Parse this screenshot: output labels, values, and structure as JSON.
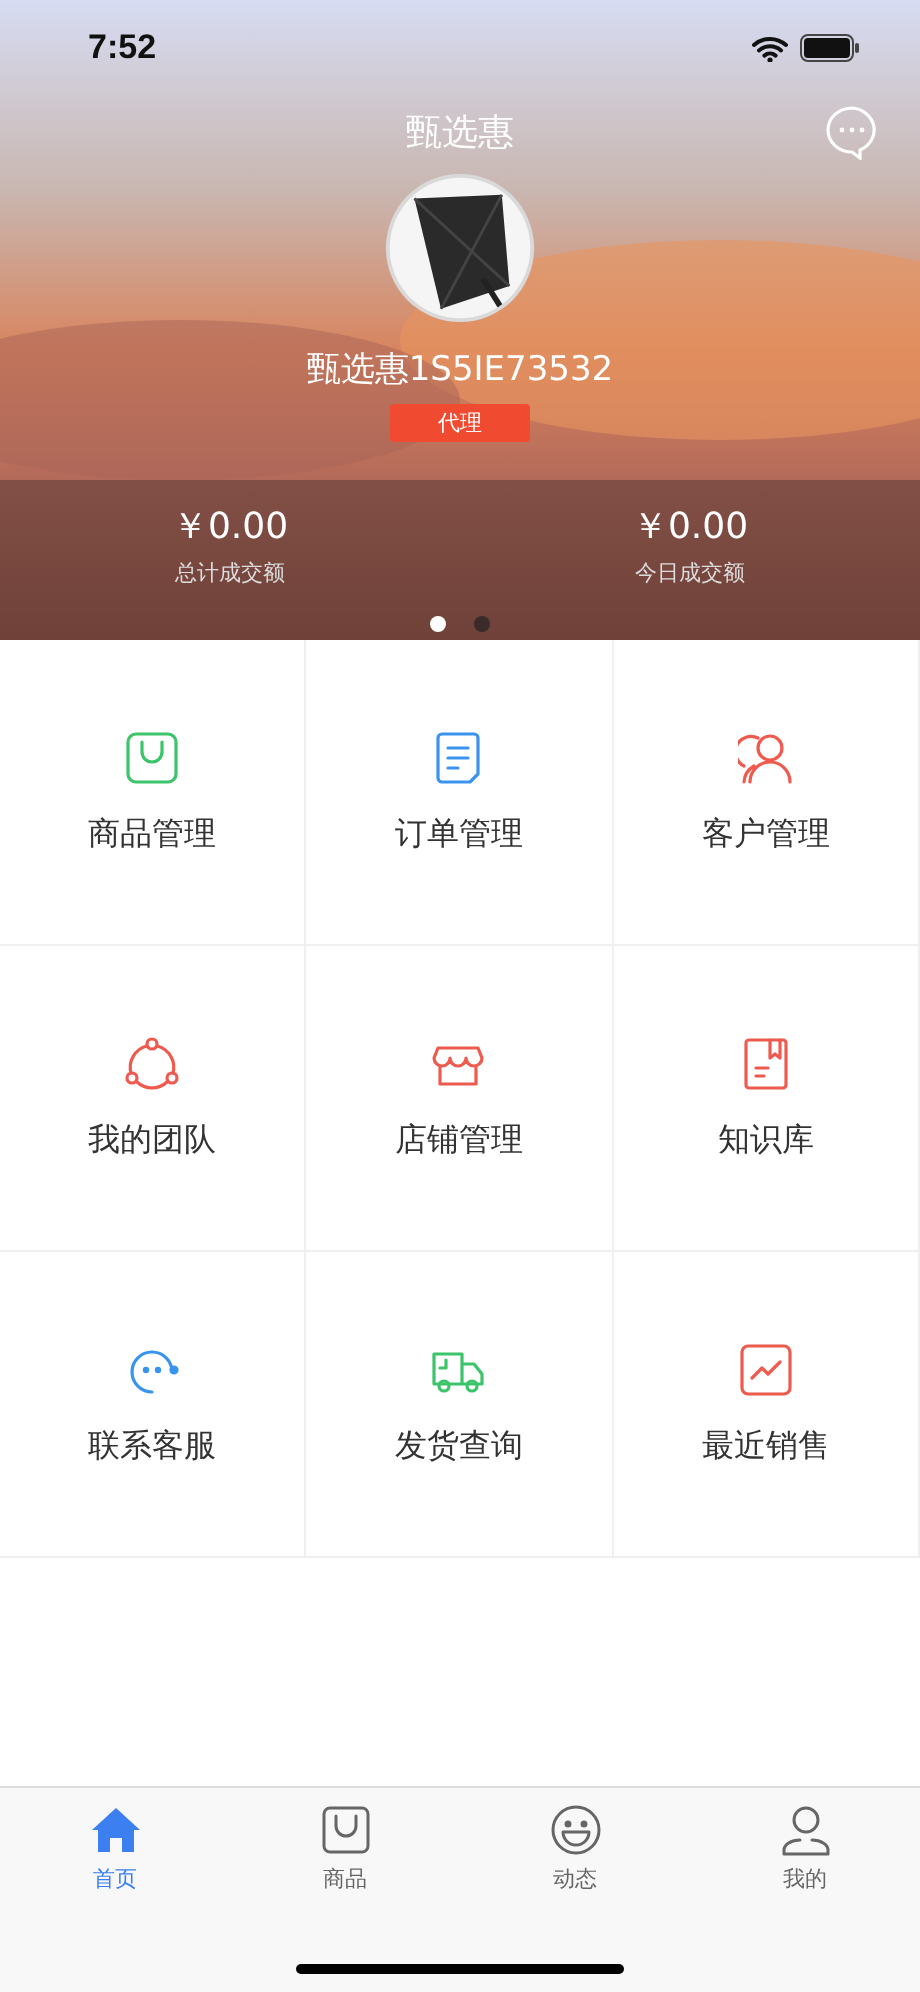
{
  "status_bar": {
    "time": "7:52"
  },
  "header": {
    "title": "甄选惠",
    "user_name": "甄选惠1S5IE73532",
    "role_badge": "代理"
  },
  "stats": [
    {
      "amount": "￥0.00",
      "label": "总计成交额"
    },
    {
      "amount": "￥0.00",
      "label": "今日成交额"
    }
  ],
  "pages": [
    {
      "selected": true
    },
    {
      "selected": false
    }
  ],
  "menu": [
    {
      "label": "商品管理",
      "color": "#3cc46a"
    },
    {
      "label": "订单管理",
      "color": "#3a94ee"
    },
    {
      "label": "客户管理",
      "color": "#ee5a4e"
    },
    {
      "label": "我的团队",
      "color": "#ee5a4e"
    },
    {
      "label": "店铺管理",
      "color": "#ee5a4e"
    },
    {
      "label": "知识库",
      "color": "#ee5a4e"
    },
    {
      "label": "联系客服",
      "color": "#3a94ee"
    },
    {
      "label": "发货查询",
      "color": "#3cc46a"
    },
    {
      "label": "最近销售",
      "color": "#ee5a4e"
    }
  ],
  "tab_bar": [
    {
      "label": "首页",
      "selected": true
    },
    {
      "label": "商品",
      "selected": false
    },
    {
      "label": "动态",
      "selected": false
    },
    {
      "label": "我的",
      "selected": false
    }
  ]
}
